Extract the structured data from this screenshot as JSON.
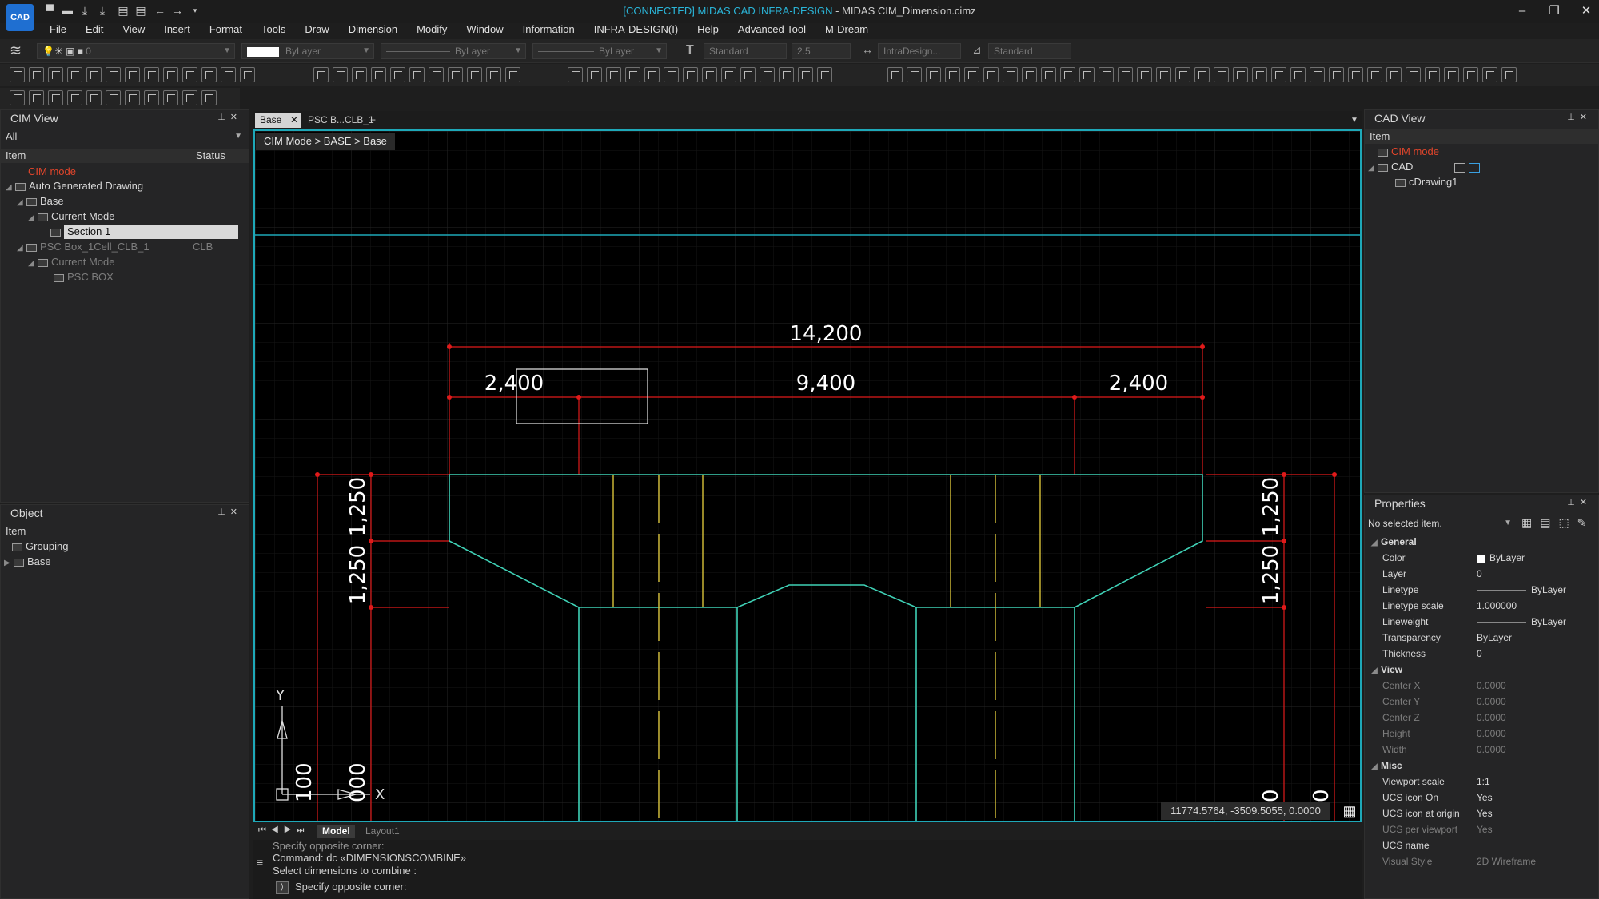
{
  "app": {
    "logo": "CAD",
    "title_connected": "[CONNECTED] MIDAS CAD INFRA-DESIGN",
    "title_rest": " - MIDAS CIM_Dimension.cimz"
  },
  "menu": [
    "File",
    "Edit",
    "View",
    "Insert",
    "Format",
    "Tools",
    "Draw",
    "Dimension",
    "Modify",
    "Window",
    "Information",
    "INFRA-DESIGN(I)",
    "Help",
    "Advanced Tool",
    "M-Dream"
  ],
  "toolbar": {
    "layer_value": "0",
    "color_value": "ByLayer",
    "linetype_value": "ByLayer",
    "lineweight_value": "ByLayer",
    "text_style": "Standard",
    "text_height": "2.5",
    "dim_style": "IntraDesign...",
    "table_style": "Standard"
  },
  "cim_view": {
    "title": "CIM View",
    "filter": "All",
    "col_item": "Item",
    "col_status": "Status",
    "rows": [
      {
        "label": "CIM mode",
        "status": ""
      },
      {
        "label": "Auto Generated Drawing",
        "status": ""
      },
      {
        "label": "Base",
        "status": ""
      },
      {
        "label": "Current Mode",
        "status": ""
      },
      {
        "label": "Section 1",
        "status": ""
      },
      {
        "label": "PSC Box_1Cell_CLB_1",
        "status": "CLB"
      },
      {
        "label": "Current Mode",
        "status": ""
      },
      {
        "label": "PSC BOX",
        "status": ""
      }
    ]
  },
  "object_panel": {
    "title": "Object",
    "col_item": "Item",
    "rows": [
      "Grouping",
      "Base"
    ]
  },
  "doc_tabs": [
    "Base",
    "PSC B...CLB_1"
  ],
  "breadcrumb": "CIM Mode > BASE > Base",
  "dimensions": {
    "overall": "14,200",
    "left": "2,400",
    "middle": "9,400",
    "right": "2,400",
    "left_v1": "1,250",
    "left_v2": "1,250",
    "right_v1": "1,250",
    "right_v2": "1,250",
    "bottom_left1": "100",
    "bottom_left2": "000",
    "bottom_right1": "0",
    "bottom_right2": "0"
  },
  "ucs": {
    "x": "X",
    "y": "Y"
  },
  "coord_readout": "11774.5764, -3509.5055, 0.0000",
  "layout_tabs": [
    "Model",
    "Layout1"
  ],
  "command": {
    "lines": [
      "Specify opposite corner:",
      "Command: dc «DIMENSIONSCOMBINE»",
      "Select dimensions to combine :"
    ],
    "prompt": "Specify opposite corner:"
  },
  "cad_view": {
    "title": "CAD View",
    "col_item": "Item",
    "rows": [
      "CIM mode",
      "CAD",
      "cDrawing1"
    ]
  },
  "properties": {
    "title": "Properties",
    "selection": "No selected item.",
    "sections": {
      "general": "General",
      "view": "View",
      "misc": "Misc"
    },
    "general": [
      {
        "name": "Color",
        "value": "ByLayer"
      },
      {
        "name": "Layer",
        "value": "0"
      },
      {
        "name": "Linetype",
        "value": "ByLayer"
      },
      {
        "name": "Linetype scale",
        "value": "1.000000"
      },
      {
        "name": "Lineweight",
        "value": "ByLayer"
      },
      {
        "name": "Transparency",
        "value": "ByLayer"
      },
      {
        "name": "Thickness",
        "value": "0"
      }
    ],
    "view": [
      {
        "name": "Center X",
        "value": "0.0000"
      },
      {
        "name": "Center Y",
        "value": "0.0000"
      },
      {
        "name": "Center Z",
        "value": "0.0000"
      },
      {
        "name": "Height",
        "value": "0.0000"
      },
      {
        "name": "Width",
        "value": "0.0000"
      }
    ],
    "misc": [
      {
        "name": "Viewport scale",
        "value": "1:1"
      },
      {
        "name": "UCS icon On",
        "value": "Yes"
      },
      {
        "name": "UCS icon at origin",
        "value": "Yes"
      },
      {
        "name": "UCS per viewport",
        "value": "Yes"
      },
      {
        "name": "UCS name",
        "value": ""
      },
      {
        "name": "Visual Style",
        "value": "2D Wireframe"
      }
    ]
  },
  "colors": {
    "accent": "#1ea8b8",
    "dimension": "#e01a1a",
    "outline": "#3fd1b6",
    "inner": "#d8c23a",
    "cim_mode": "#e0452b"
  }
}
